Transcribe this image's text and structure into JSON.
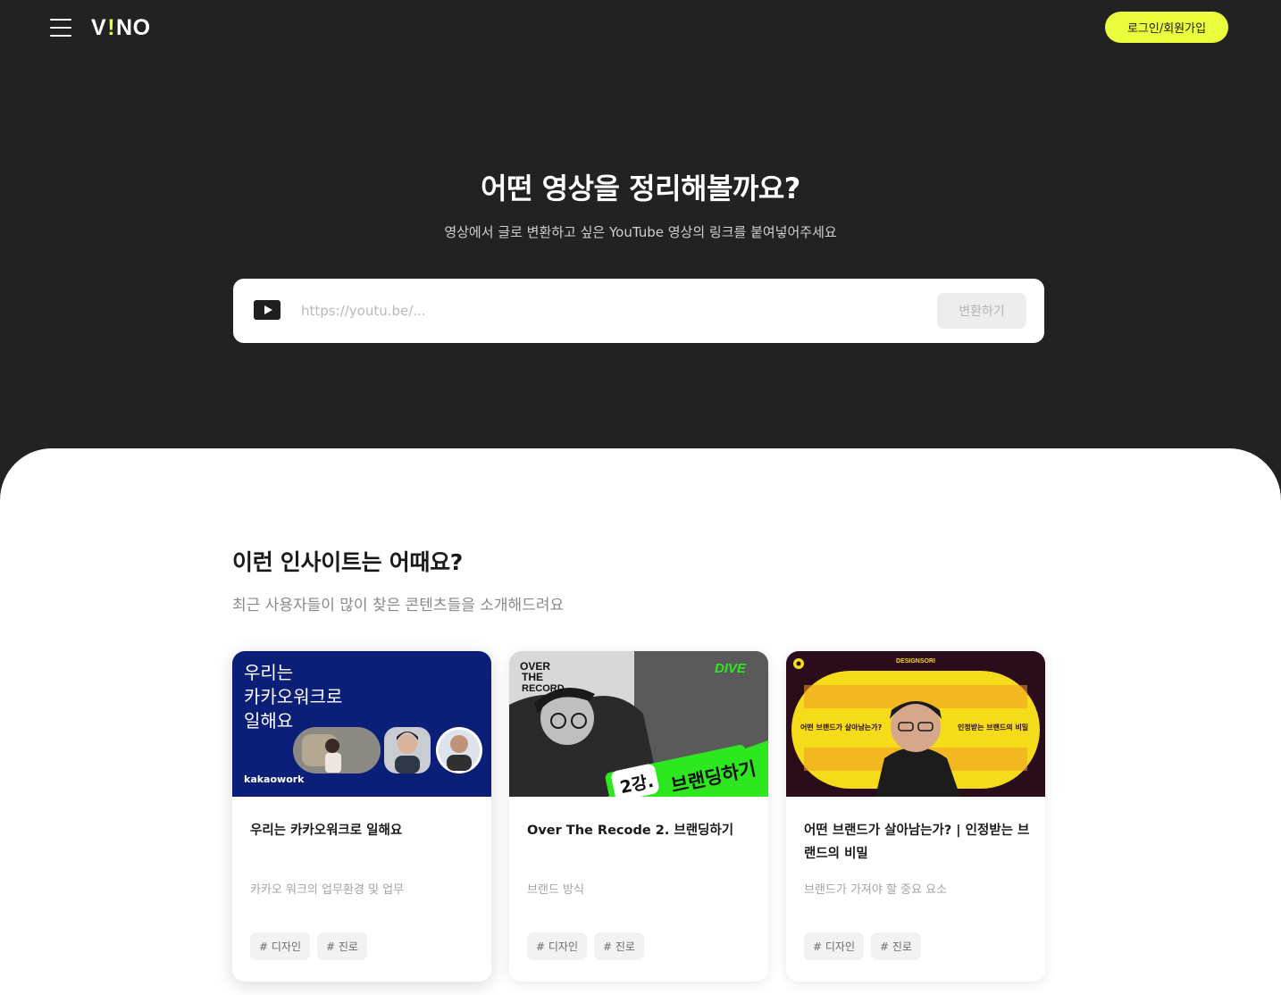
{
  "header": {
    "logo_left": "V",
    "logo_mark": "!",
    "logo_right": "NO",
    "login_label": "로그인/회원가입"
  },
  "hero": {
    "title": "어떤 영상을 정리해볼까요?",
    "subtitle": "영상에서 글로 변환하고 싶은 YouTube 영상의 링크를 붙여넣어주세요",
    "input_placeholder": "https://youtu.be/...",
    "input_value": "",
    "convert_label": "변환하기"
  },
  "insights": {
    "title": "이런 인사이트는 어때요?",
    "subtitle": "최근 사용자들이 많이 찾은 콘텐츠들을 소개해드려요",
    "cards": [
      {
        "title": "우리는 카카오워크로 일해요",
        "desc": "카카오 워크의 업무환경 및 업무",
        "tags": [
          "# 디자인",
          "# 진로"
        ],
        "thumb": {
          "line1": "우리는",
          "line2": "카카오워크로",
          "line3": "일해요",
          "brand": "kakaowork",
          "bg": "#0c1f78"
        }
      },
      {
        "title": "Over The Recode 2. 브랜딩하기",
        "desc": "브랜드 방식",
        "tags": [
          "# 디자인",
          "# 진로"
        ],
        "thumb": {
          "over": "OVER",
          "the": "THE",
          "record": "RECORD",
          "dive": "DIVE",
          "lecture": "2강.",
          "topic": "브랜딩하기",
          "accent": "#2ee81f"
        }
      },
      {
        "title": "어떤 브랜드가 살아남는가?  |  인정받는 브랜드의 비밀",
        "desc": "브랜드가 가져야 할 중요 요소",
        "tags": [
          "# 디자인",
          "# 진로"
        ],
        "thumb": {
          "brand": "DESIGNSORI",
          "left_caption": "어떤 브랜드가 살아남는가?",
          "right_caption": "인정받는 브랜드의 비밀",
          "accent": "#f5dc1a",
          "bg": "#2a0c1a"
        }
      }
    ]
  }
}
